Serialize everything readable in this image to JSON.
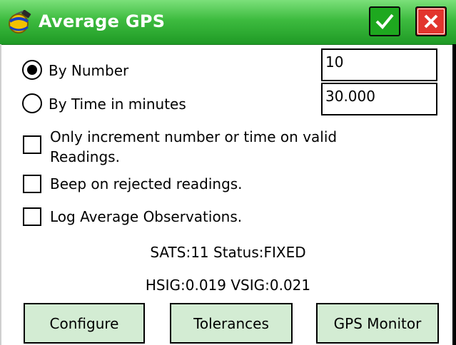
{
  "window": {
    "title": "Average GPS",
    "logo_icon": "gps-satellite-icon",
    "ok_icon": "checkmark-icon",
    "close_icon": "close-x-icon",
    "titlebar_color": "#3dbb3f"
  },
  "options": {
    "by_number": {
      "label": "By Number",
      "selected": true,
      "value": "10"
    },
    "by_time": {
      "label": "By Time in minutes",
      "selected": false,
      "value": "30.000"
    }
  },
  "checks": [
    {
      "line1": "Only increment number or time on valid",
      "line2": "Readings.",
      "checked": false
    },
    {
      "label": "Beep on rejected readings.",
      "checked": false
    },
    {
      "label": "Log Average Observations.",
      "checked": false
    }
  ],
  "status": {
    "line1": "SATS:11 Status:FIXED",
    "line2": "HSIG:0.019  VSIG:0.021"
  },
  "buttons": {
    "configure": "Configure",
    "tolerances": "Tolerances",
    "gps_monitor": "GPS Monitor",
    "button_color": "#d3ecd3"
  }
}
